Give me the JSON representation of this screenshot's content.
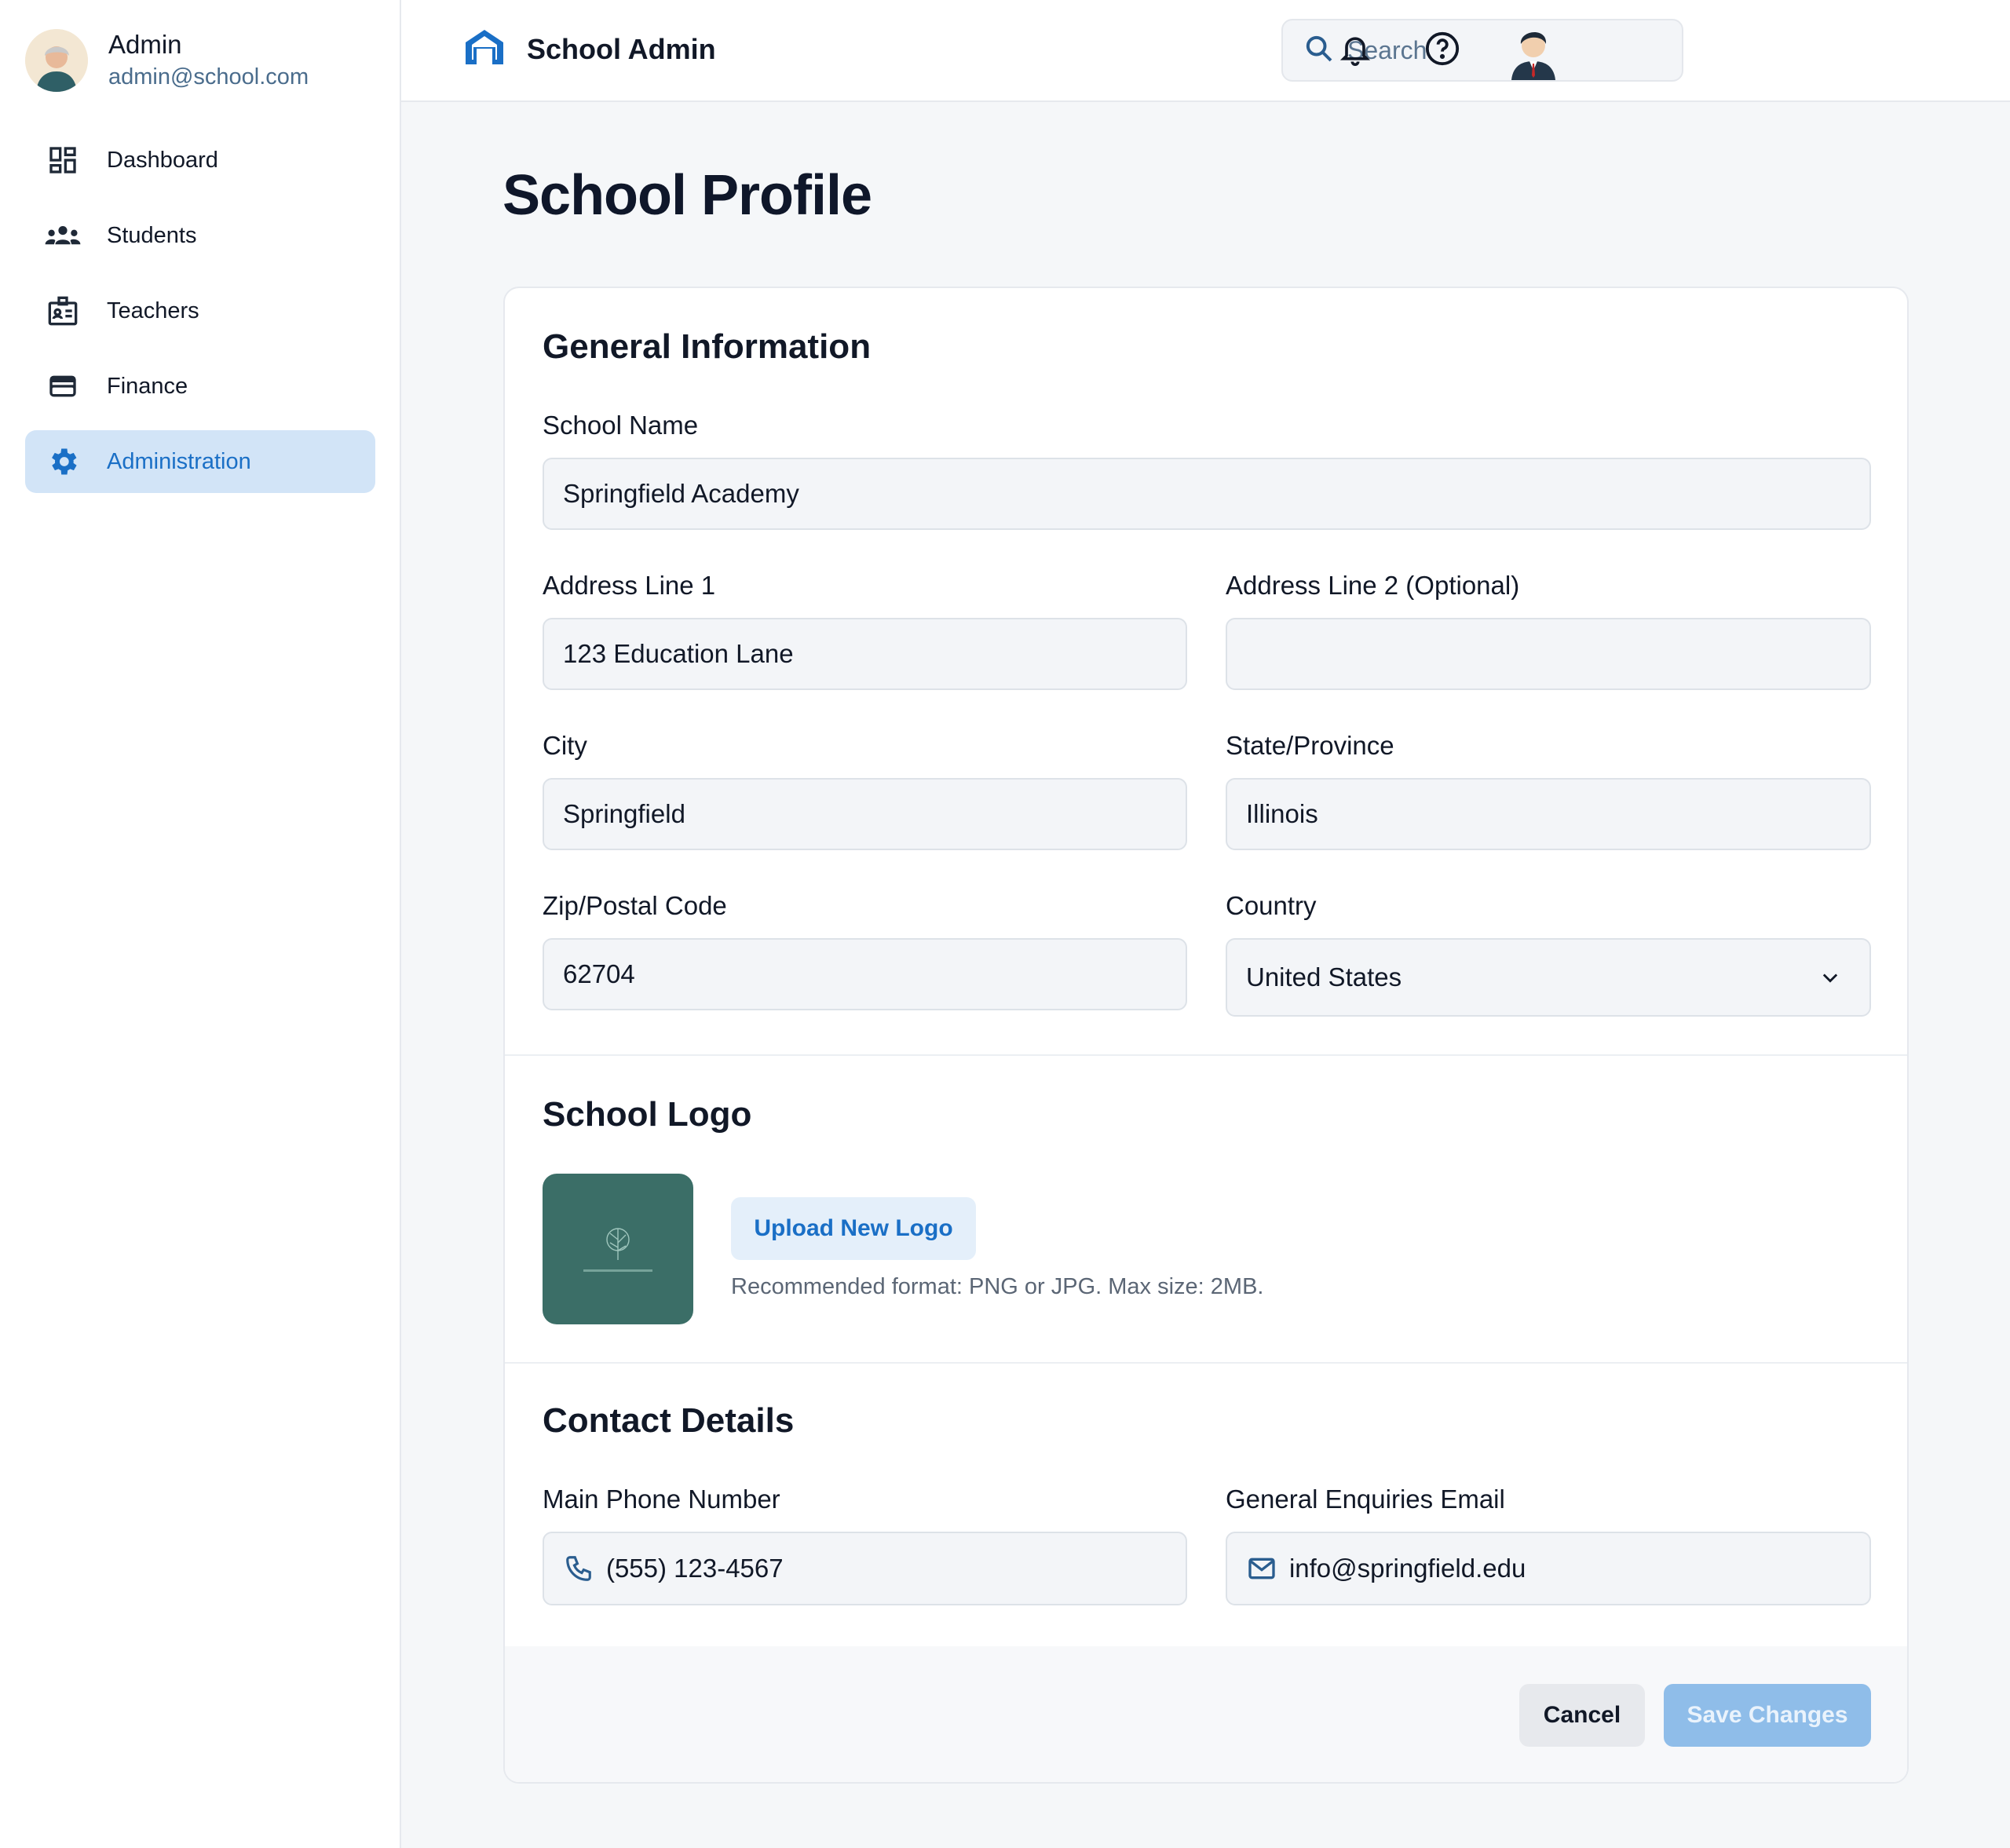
{
  "user": {
    "name": "Admin",
    "email": "admin@school.com"
  },
  "sidebar": {
    "items": [
      {
        "label": "Dashboard",
        "icon": "dashboard-icon",
        "active": false
      },
      {
        "label": "Students",
        "icon": "group-icon",
        "active": false
      },
      {
        "label": "Teachers",
        "icon": "badge-icon",
        "active": false
      },
      {
        "label": "Finance",
        "icon": "wallet-icon",
        "active": false
      },
      {
        "label": "Administration",
        "icon": "gear-icon",
        "active": true
      }
    ]
  },
  "header": {
    "title": "School Admin",
    "search_placeholder": "Search"
  },
  "page": {
    "title": "School Profile"
  },
  "general": {
    "title": "General Information",
    "school_name": {
      "label": "School Name",
      "value": "Springfield Academy"
    },
    "address1": {
      "label": "Address Line 1",
      "value": "123 Education Lane"
    },
    "address2": {
      "label": "Address Line 2 (Optional)",
      "value": ""
    },
    "city": {
      "label": "City",
      "value": "Springfield"
    },
    "state": {
      "label": "State/Province",
      "value": "Illinois"
    },
    "zip": {
      "label": "Zip/Postal Code",
      "value": "62704"
    },
    "country": {
      "label": "Country",
      "value": "United States"
    }
  },
  "logo": {
    "title": "School Logo",
    "upload_label": "Upload New Logo",
    "hint": "Recommended format: PNG or JPG. Max size: 2MB."
  },
  "contact": {
    "title": "Contact Details",
    "phone": {
      "label": "Main Phone Number",
      "value": "(555) 123-4567"
    },
    "email": {
      "label": "General Enquiries Email",
      "value": "info@springfield.edu"
    }
  },
  "actions": {
    "cancel": "Cancel",
    "save": "Save Changes"
  },
  "colors": {
    "accent": "#1a6fc6",
    "active_nav_bg": "#d2e4f7",
    "save_button": "#8fbde9",
    "logo_bg": "#3b6e67"
  }
}
